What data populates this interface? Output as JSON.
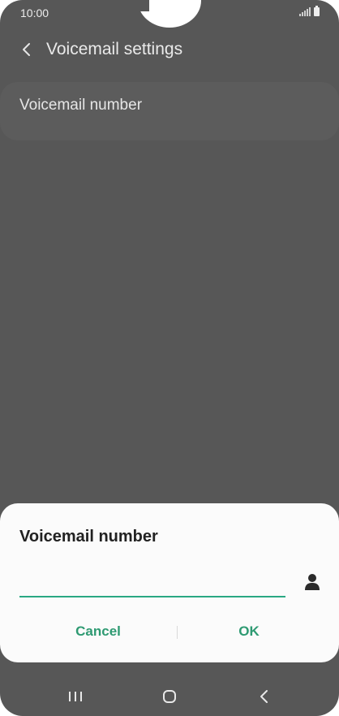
{
  "status_bar": {
    "time": "10:00",
    "icons": [
      "signal-icon",
      "battery-icon"
    ]
  },
  "header": {
    "back_icon": "chevron-left-icon",
    "title": "Voicemail settings"
  },
  "settings": {
    "items": [
      {
        "label": "Voicemail number"
      }
    ]
  },
  "dialog": {
    "title": "Voicemail number",
    "input": {
      "value": "",
      "placeholder": ""
    },
    "contacts_icon": "contact-person-icon",
    "cancel_label": "Cancel",
    "ok_label": "OK"
  },
  "nav_bar": {
    "icons": [
      "recent-apps-icon",
      "home-icon",
      "back-icon"
    ]
  },
  "colors": {
    "accent": "#2e9a72",
    "input_underline": "#2aa883",
    "scrim_background": "#575757",
    "dialog_background": "#fbfbfb"
  }
}
